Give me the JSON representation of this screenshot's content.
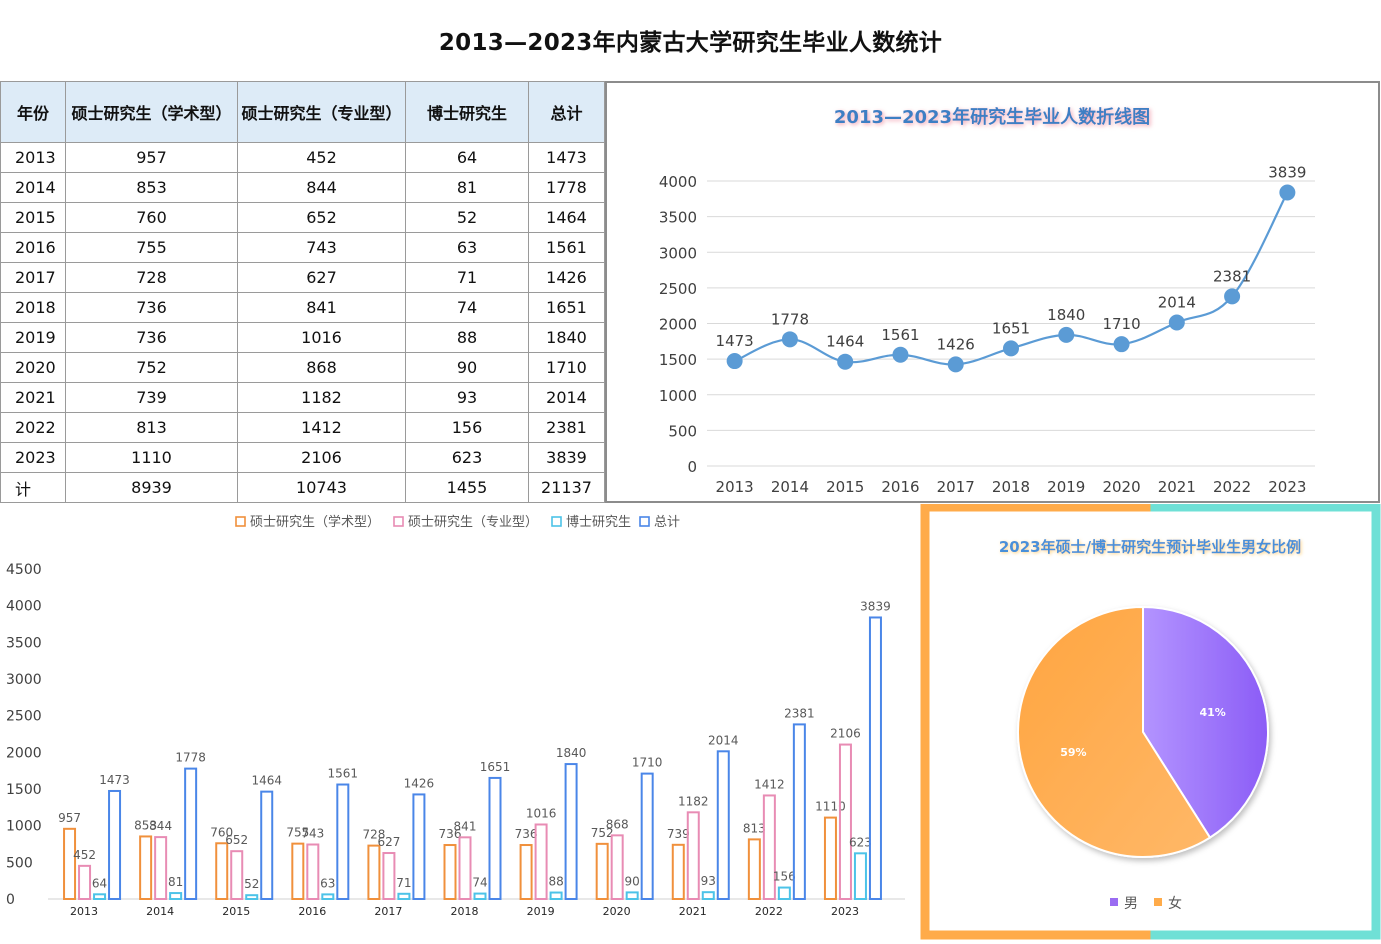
{
  "page_title": "2013—2023年内蒙古大学研究生毕业人数统计",
  "table": {
    "headers": [
      "年份",
      "硕士研究生（学术型）",
      "硕士研究生（专业型）",
      "博士研究生",
      "总计"
    ],
    "rows": [
      [
        "2013",
        "957",
        "452",
        "64",
        "1473"
      ],
      [
        "2014",
        "853",
        "844",
        "81",
        "1778"
      ],
      [
        "2015",
        "760",
        "652",
        "52",
        "1464"
      ],
      [
        "2016",
        "755",
        "743",
        "63",
        "1561"
      ],
      [
        "2017",
        "728",
        "627",
        "71",
        "1426"
      ],
      [
        "2018",
        "736",
        "841",
        "74",
        "1651"
      ],
      [
        "2019",
        "736",
        "1016",
        "88",
        "1840"
      ],
      [
        "2020",
        "752",
        "868",
        "90",
        "1710"
      ],
      [
        "2021",
        "739",
        "1182",
        "93",
        "2014"
      ],
      [
        "2022",
        "813",
        "1412",
        "156",
        "2381"
      ],
      [
        "2023",
        "1110",
        "2106",
        "623",
        "3839"
      ],
      [
        "计",
        "8939",
        "10743",
        "1455",
        "21137"
      ]
    ]
  },
  "chart_data": [
    {
      "type": "line",
      "title": "2013—2023年研究生毕业人数折线图",
      "x": [
        "2013",
        "2014",
        "2015",
        "2016",
        "2017",
        "2018",
        "2019",
        "2020",
        "2021",
        "2022",
        "2023"
      ],
      "values": [
        1473,
        1778,
        1464,
        1561,
        1426,
        1651,
        1840,
        1710,
        2014,
        2381,
        3839
      ],
      "ylim": [
        0,
        4000
      ],
      "yticks": [
        0,
        500,
        1000,
        1500,
        2000,
        2500,
        3000,
        3500,
        4000
      ],
      "grid": true,
      "color": "#5b9bd5"
    },
    {
      "type": "bar",
      "categories": [
        "2013",
        "2014",
        "2015",
        "2016",
        "2017",
        "2018",
        "2019",
        "2020",
        "2021",
        "2022",
        "2023"
      ],
      "series": [
        {
          "name": "硕士研究生（学术型）",
          "color": "#f0903c",
          "values": [
            957,
            853,
            760,
            755,
            728,
            736,
            736,
            752,
            739,
            813,
            1110
          ]
        },
        {
          "name": "硕士研究生（专业型）",
          "color": "#e88cb4",
          "values": [
            452,
            844,
            652,
            743,
            627,
            841,
            1016,
            868,
            1182,
            1412,
            2106
          ]
        },
        {
          "name": "博士研究生",
          "color": "#4cc3e8",
          "values": [
            64,
            81,
            52,
            63,
            71,
            74,
            88,
            90,
            93,
            156,
            623
          ]
        },
        {
          "name": "总计",
          "color": "#4a86e8",
          "values": [
            1473,
            1778,
            1464,
            1561,
            1426,
            1651,
            1840,
            1710,
            2014,
            2381,
            3839
          ]
        }
      ],
      "ylim": [
        0,
        4500
      ],
      "yticks": [
        0,
        500,
        1000,
        1500,
        2000,
        2500,
        3000,
        3500,
        4000,
        4500
      ],
      "legend_position": "top",
      "grid": false
    },
    {
      "type": "pie",
      "title": "2023年硕士/博士研究生预计毕业生男女比例",
      "slices": [
        {
          "name": "男",
          "value": 41,
          "label": "41%",
          "color": "#9a6cf2"
        },
        {
          "name": "女",
          "value": 59,
          "label": "59%",
          "color": "#ffab4a"
        }
      ],
      "legend_position": "bottom"
    }
  ]
}
